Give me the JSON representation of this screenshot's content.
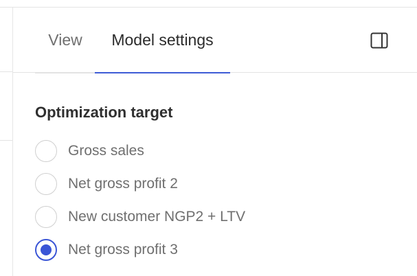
{
  "tabs": [
    {
      "label": "View",
      "active": false
    },
    {
      "label": "Model settings",
      "active": true
    }
  ],
  "panel_toggle_icon": "sidebar-toggle-icon",
  "optimization": {
    "title": "Optimization target",
    "options": [
      {
        "label": "Gross sales",
        "selected": false
      },
      {
        "label": "Net gross profit 2",
        "selected": false
      },
      {
        "label": "New customer NGP2 + LTV",
        "selected": false
      },
      {
        "label": "Net gross profit 3",
        "selected": true
      }
    ]
  },
  "colors": {
    "accent": "#3a55d6",
    "text_primary": "#2b2b2b",
    "text_secondary": "#6f6f6f",
    "border": "#e3e3e3"
  }
}
